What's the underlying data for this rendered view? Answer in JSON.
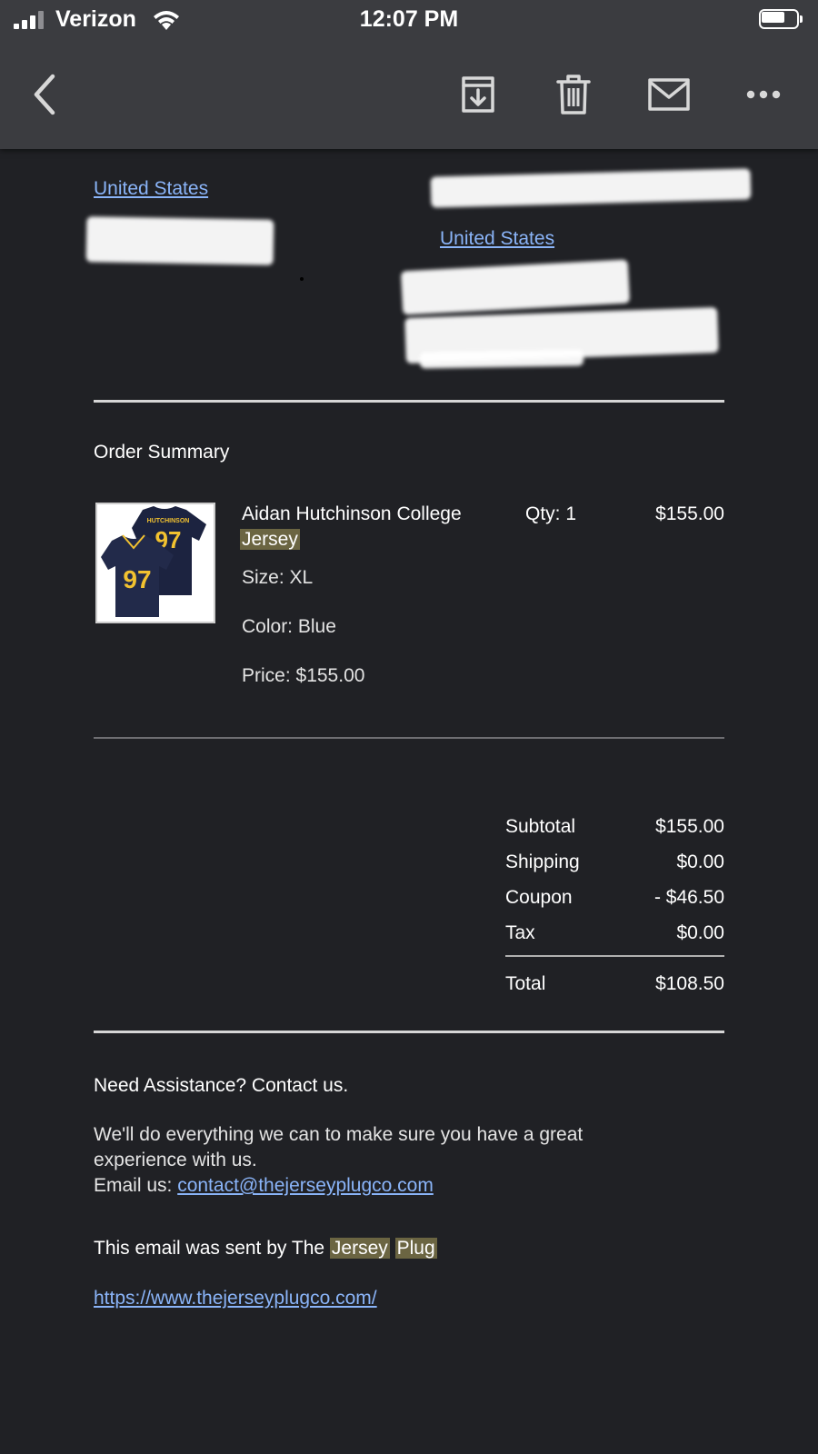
{
  "status_bar": {
    "carrier": "Verizon",
    "time": "12:07 PM",
    "battery_level": 0.7
  },
  "toolbar": {
    "icons": [
      "back-arrow-icon",
      "archive-icon",
      "trash-icon",
      "mail-icon",
      "more-icon"
    ]
  },
  "addresses": {
    "left_country": "United States",
    "right_country": "United States"
  },
  "order": {
    "heading": "Order Summary",
    "item": {
      "name_line1": "Aidan Hutchinson College",
      "name_line2": "Jersey",
      "qty": "Qty: 1",
      "price_right": "$155.00",
      "size": "Size: XL",
      "color": "Color: Blue",
      "price": "Price: $155.00",
      "jersey_number": "97",
      "jersey_name": "HUTCHINSON"
    },
    "totals": [
      {
        "label": "Subtotal",
        "value": "$155.00"
      },
      {
        "label": "Shipping",
        "value": "$0.00"
      },
      {
        "label": "Coupon",
        "value": "- $46.50"
      },
      {
        "label": "Tax",
        "value": "$0.00"
      }
    ],
    "total": {
      "label": "Total",
      "value": "$108.50"
    }
  },
  "footer": {
    "heading": "Need Assistance? Contact us.",
    "body_line1": "We'll do everything we can to make sure you have a great",
    "body_line2": "experience with us.",
    "email_prefix": "Email us: ",
    "email": "contact@thejerseyplugco.com",
    "sent_by_prefix": "This email was sent by The ",
    "sent_by_word1": "Jersey",
    "sent_by_word2": "Plug",
    "url": "https://www.thejerseyplugco.com/"
  },
  "colors": {
    "background": "#202125",
    "toolbar": "#3b3c40",
    "link": "#8ab4f8",
    "highlight": "#6b6542",
    "jersey_navy": "#1c2340",
    "jersey_maize": "#f2c230"
  }
}
